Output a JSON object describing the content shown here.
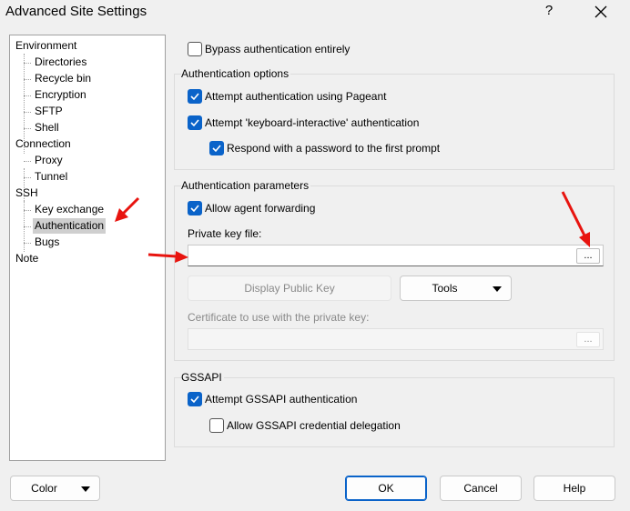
{
  "window": {
    "title": "Advanced Site Settings",
    "help_glyph": "?",
    "close_icon": "close-icon"
  },
  "tree": {
    "nodes": [
      {
        "label": "Environment",
        "level": 0
      },
      {
        "label": "Directories",
        "level": 1
      },
      {
        "label": "Recycle bin",
        "level": 1
      },
      {
        "label": "Encryption",
        "level": 1
      },
      {
        "label": "SFTP",
        "level": 1
      },
      {
        "label": "Shell",
        "level": 1
      },
      {
        "label": "Connection",
        "level": 0
      },
      {
        "label": "Proxy",
        "level": 1
      },
      {
        "label": "Tunnel",
        "level": 1
      },
      {
        "label": "SSH",
        "level": 0
      },
      {
        "label": "Key exchange",
        "level": 1
      },
      {
        "label": "Authentication",
        "level": 1,
        "selected": true
      },
      {
        "label": "Bugs",
        "level": 1
      },
      {
        "label": "Note",
        "level": 0
      }
    ]
  },
  "bypass": {
    "label": "Bypass authentication entirely",
    "checked": false
  },
  "auth_options": {
    "title": "Authentication options",
    "pageant": {
      "label": "Attempt authentication using Pageant",
      "checked": true
    },
    "keyboard_interactive": {
      "label": "Attempt 'keyboard-interactive' authentication",
      "checked": true
    },
    "respond_password": {
      "label": "Respond with a password to the first prompt",
      "checked": true
    }
  },
  "auth_params": {
    "title": "Authentication parameters",
    "agent_forwarding": {
      "label": "Allow agent forwarding",
      "checked": true
    },
    "private_key_label": "Private key file:",
    "private_key_value": "",
    "browse_label": "...",
    "display_public_key": "Display Public Key",
    "tools": "Tools",
    "certificate_label": "Certificate to use with the private key:",
    "certificate_value": "",
    "certificate_browse": "..."
  },
  "gssapi": {
    "title": "GSSAPI",
    "attempt": {
      "label": "Attempt GSSAPI authentication",
      "checked": true
    },
    "delegation": {
      "label": "Allow GSSAPI credential delegation",
      "checked": false
    }
  },
  "footer": {
    "color": "Color",
    "ok": "OK",
    "cancel": "Cancel",
    "help": "Help"
  },
  "colors": {
    "accent": "#0a63c9",
    "annotation_arrow": "#e8140f",
    "tree_selection": "#cfcfcf"
  }
}
